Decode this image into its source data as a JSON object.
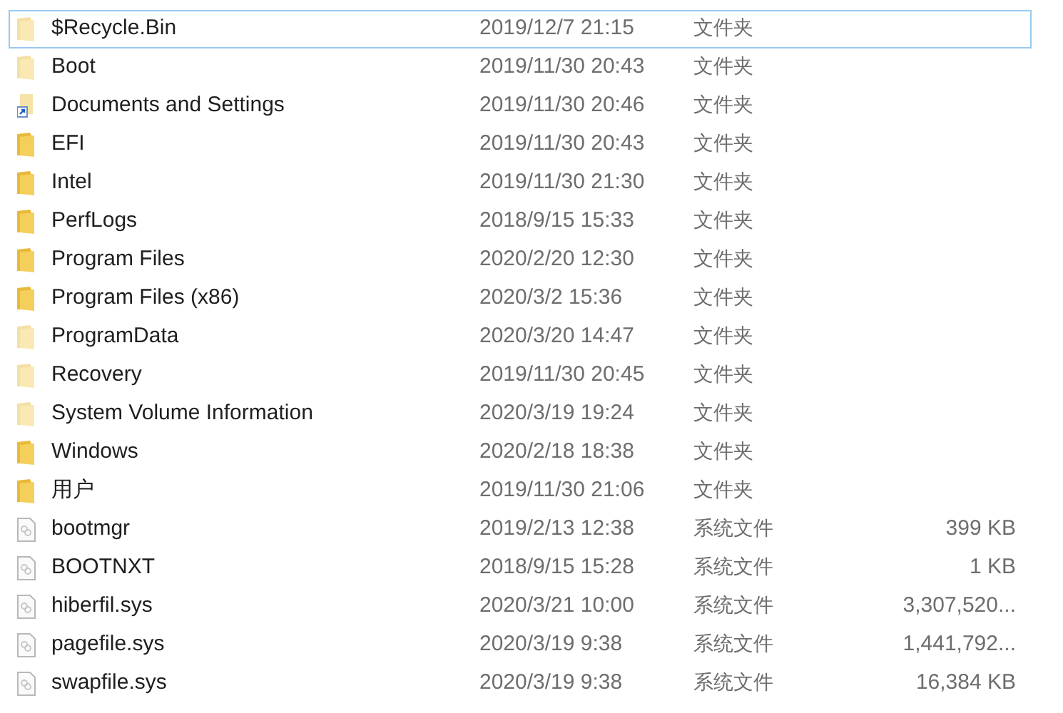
{
  "files": [
    {
      "kind": "folder",
      "hidden": true,
      "focused": true,
      "name": "$Recycle.Bin",
      "modified": "2019/12/7 21:15",
      "type": "文件夹"
    },
    {
      "kind": "folder",
      "hidden": true,
      "focused": false,
      "name": "Boot",
      "modified": "2019/11/30 20:43",
      "type": "文件夹"
    },
    {
      "kind": "shortcut",
      "focused": false,
      "name": "Documents and Settings",
      "modified": "2019/11/30 20:46",
      "type": "文件夹"
    },
    {
      "kind": "folder",
      "hidden": false,
      "focused": false,
      "name": "EFI",
      "modified": "2019/11/30 20:43",
      "type": "文件夹"
    },
    {
      "kind": "folder",
      "hidden": false,
      "focused": false,
      "name": "Intel",
      "modified": "2019/11/30 21:30",
      "type": "文件夹"
    },
    {
      "kind": "folder",
      "hidden": false,
      "focused": false,
      "name": "PerfLogs",
      "modified": "2018/9/15 15:33",
      "type": "文件夹"
    },
    {
      "kind": "folder",
      "hidden": false,
      "focused": false,
      "name": "Program Files",
      "modified": "2020/2/20 12:30",
      "type": "文件夹"
    },
    {
      "kind": "folder",
      "hidden": false,
      "focused": false,
      "name": "Program Files (x86)",
      "modified": "2020/3/2 15:36",
      "type": "文件夹"
    },
    {
      "kind": "folder",
      "hidden": true,
      "focused": false,
      "name": "ProgramData",
      "modified": "2020/3/20 14:47",
      "type": "文件夹"
    },
    {
      "kind": "folder",
      "hidden": true,
      "focused": false,
      "name": "Recovery",
      "modified": "2019/11/30 20:45",
      "type": "文件夹"
    },
    {
      "kind": "folder",
      "hidden": true,
      "focused": false,
      "name": "System Volume Information",
      "modified": "2020/3/19 19:24",
      "type": "文件夹"
    },
    {
      "kind": "folder",
      "hidden": false,
      "focused": false,
      "name": "Windows",
      "modified": "2020/2/18 18:38",
      "type": "文件夹"
    },
    {
      "kind": "folder",
      "hidden": false,
      "focused": false,
      "name": "用户",
      "modified": "2019/11/30 21:06",
      "type": "文件夹"
    },
    {
      "kind": "file",
      "focused": false,
      "name": "bootmgr",
      "modified": "2019/2/13 12:38",
      "type": "系统文件",
      "size": "399 KB"
    },
    {
      "kind": "file",
      "focused": false,
      "name": "BOOTNXT",
      "modified": "2018/9/15 15:28",
      "type": "系统文件",
      "size": "1 KB"
    },
    {
      "kind": "file",
      "focused": false,
      "name": "hiberfil.sys",
      "modified": "2020/3/21 10:00",
      "type": "系统文件",
      "size": "3,307,520..."
    },
    {
      "kind": "file",
      "focused": false,
      "name": "pagefile.sys",
      "modified": "2020/3/19 9:38",
      "type": "系统文件",
      "size": "1,441,792..."
    },
    {
      "kind": "file",
      "focused": false,
      "name": "swapfile.sys",
      "modified": "2020/3/19 9:38",
      "type": "系统文件",
      "size": "16,384 KB"
    }
  ]
}
